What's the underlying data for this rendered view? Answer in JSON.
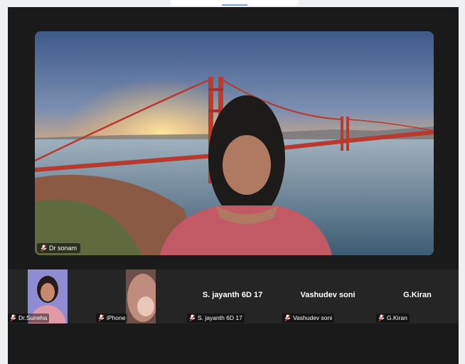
{
  "meeting": {
    "active_speaker": {
      "name": "Dr sonam"
    },
    "participants": [
      {
        "name": "Dr.Suneha",
        "display_name": "",
        "muted": true,
        "video": true
      },
      {
        "name": "iPhone",
        "display_name": "",
        "muted": true,
        "video": true
      },
      {
        "name": "S. jayanth 6D 17",
        "display_name": "S. jayanth 6D 17",
        "muted": true,
        "video": false
      },
      {
        "name": "Vashudev soni",
        "display_name": "Vashudev soni",
        "muted": true,
        "video": false
      },
      {
        "name": "G.Kiran",
        "display_name": "G.Kiran",
        "muted": true,
        "video": false
      }
    ]
  },
  "icons": {
    "muted": "mic-muted-icon",
    "unmuted": "mic-icon"
  },
  "colors": {
    "window_bg": "#1a1a1a",
    "strip_bg": "#252525",
    "muted_red": "#e53935"
  }
}
